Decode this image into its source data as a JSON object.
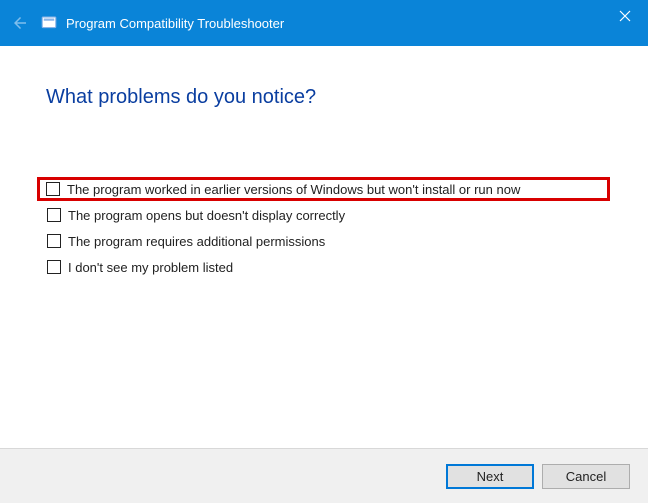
{
  "titlebar": {
    "title": "Program Compatibility Troubleshooter"
  },
  "content": {
    "heading": "What problems do you notice?",
    "options": [
      {
        "label": "The program worked in earlier versions of Windows but won't install or run now",
        "checked": false,
        "highlighted": true
      },
      {
        "label": "The program opens but doesn't display correctly",
        "checked": false,
        "highlighted": false
      },
      {
        "label": "The program requires additional permissions",
        "checked": false,
        "highlighted": false
      },
      {
        "label": "I don't see my problem listed",
        "checked": false,
        "highlighted": false
      }
    ]
  },
  "footer": {
    "next": "Next",
    "cancel": "Cancel"
  }
}
